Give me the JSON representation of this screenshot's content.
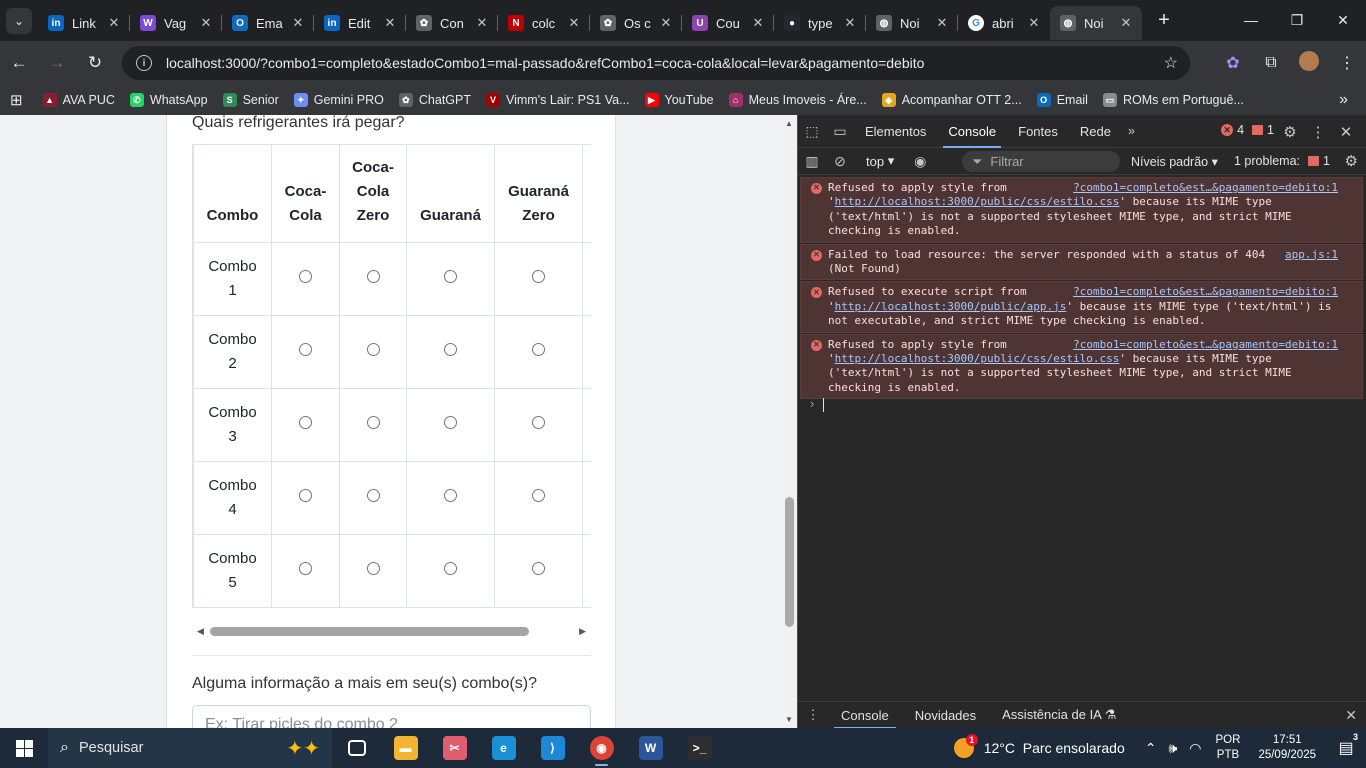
{
  "browser": {
    "tabs": [
      {
        "label": "Link",
        "icon": "linkedin-icon",
        "color": "#0a66c2",
        "glyph": "in"
      },
      {
        "label": "Vag",
        "icon": "vagas-icon",
        "color": "#7b4bd6",
        "glyph": "W"
      },
      {
        "label": "Ema",
        "icon": "outlook-icon",
        "color": "#0f6cbd",
        "glyph": "O"
      },
      {
        "label": "Edit",
        "icon": "linkedin-icon",
        "color": "#0a66c2",
        "glyph": "in"
      },
      {
        "label": "Con",
        "icon": "chatgpt-icon",
        "color": "#5f6368",
        "glyph": "✿"
      },
      {
        "label": "colc",
        "icon": "netflix-icon",
        "color": "#c00000",
        "glyph": "N"
      },
      {
        "label": "Os c",
        "icon": "chatgpt-icon",
        "color": "#5f6368",
        "glyph": "✿"
      },
      {
        "label": "Cou",
        "icon": "purple-app-icon",
        "color": "#8e44ad",
        "glyph": "U"
      },
      {
        "label": "type",
        "icon": "github-icon",
        "color": "#24292f",
        "glyph": "●"
      },
      {
        "label": "Noi",
        "icon": "globe-icon",
        "color": "#5f6368",
        "glyph": "◍"
      },
      {
        "label": "abri",
        "icon": "google-icon",
        "color": "#ffffff",
        "glyph": "G"
      },
      {
        "label": "Noi",
        "icon": "globe-icon",
        "color": "#5f6368",
        "glyph": "◍",
        "active": true
      }
    ],
    "url": "localhost:3000/?combo1=completo&estadoCombo1=mal-passado&refCombo1=coca-cola&local=levar&pagamento=debito",
    "bookmarks": [
      {
        "label": "AVA PUC",
        "icon": "ava-icon",
        "color": "#8b1e2d",
        "glyph": "▲"
      },
      {
        "label": "WhatsApp",
        "icon": "whatsapp-icon",
        "color": "#25d366",
        "glyph": "✆"
      },
      {
        "label": "Senior",
        "icon": "senior-icon",
        "color": "#2e8b57",
        "glyph": "S"
      },
      {
        "label": "Gemini PRO",
        "icon": "gemini-icon",
        "color": "#6a8cff",
        "glyph": "✦"
      },
      {
        "label": "ChatGPT",
        "icon": "chatgpt-icon",
        "color": "#5f6368",
        "glyph": "✿"
      },
      {
        "label": "Vimm's Lair: PS1 Va...",
        "icon": "vimm-icon",
        "color": "#a00000",
        "glyph": "V"
      },
      {
        "label": "YouTube",
        "icon": "youtube-icon",
        "color": "#ff0000",
        "glyph": "▶"
      },
      {
        "label": "Meus Imoveis - Áre...",
        "icon": "imoveis-icon",
        "color": "#a0306b",
        "glyph": "⌂"
      },
      {
        "label": "Acompanhar OTT 2...",
        "icon": "ott-icon",
        "color": "#e3a81b",
        "glyph": "◆"
      },
      {
        "label": "Email",
        "icon": "outlook-icon",
        "color": "#0f6cbd",
        "glyph": "O"
      },
      {
        "label": "ROMs em Portuguê...",
        "icon": "folder-icon",
        "color": "#8a8a8a",
        "glyph": "▭"
      }
    ]
  },
  "form": {
    "question": "Quais refrigerantes irá pegar?",
    "columns": [
      "Combo",
      "Coca-\nCola",
      "Coca-\nCola\nZero",
      "Guaraná",
      "Guaraná\nZero"
    ],
    "rows": [
      "Combo\n1",
      "Combo\n2",
      "Combo\n3",
      "Combo\n4",
      "Combo\n5"
    ],
    "extra_label": "Alguma informação a mais em seu(s) combo(s)?",
    "extra_placeholder": "Ex: Tirar picles do combo 2"
  },
  "devtools": {
    "tabs": [
      "Elementos",
      "Console",
      "Fontes",
      "Rede"
    ],
    "active_tab": "Console",
    "error_count": "4",
    "issue_count": "1",
    "context": "top",
    "filter_placeholder": "Filtrar",
    "levels": "Níveis padrão",
    "problems": "1 problema:",
    "problems_count": "1",
    "messages": [
      {
        "source": "?combo1=completo&est…&pagamento=debito:1",
        "pre": "Refused to apply style from '",
        "link": "http://localhost:3000/public/css/estilo.css",
        "post": "' because its MIME type ('text/html') is not a supported stylesheet MIME type, and strict MIME checking is enabled."
      },
      {
        "source": "app.js:1",
        "pre": "Failed to load resource: the server responded with a status of 404 (Not Found)",
        "link": "",
        "post": ""
      },
      {
        "source": "?combo1=completo&est…&pagamento=debito:1",
        "pre": "Refused to execute script from '",
        "link": "http://localhost:3000/public/app.js",
        "post": "' because its MIME type ('text/html') is not executable, and strict MIME type checking is enabled."
      },
      {
        "source": "?combo1=completo&est…&pagamento=debito:1",
        "pre": "Refused to apply style from '",
        "link": "http://localhost:3000/public/css/estilo.css",
        "post": "' because its MIME type ('text/html') is not a supported stylesheet MIME type, and strict MIME checking is enabled."
      }
    ],
    "drawer_tabs": [
      "Console",
      "Novidades",
      "Assistência de IA ⚗"
    ]
  },
  "taskbar": {
    "search": "Pesquisar",
    "apps": [
      {
        "name": "task-view-icon",
        "color": "#1c2a3a",
        "glyph": "▣"
      },
      {
        "name": "file-explorer-icon",
        "color": "#f3b52f",
        "glyph": "▬"
      },
      {
        "name": "snipping-tool-icon",
        "color": "#e05d6f",
        "glyph": "✂"
      },
      {
        "name": "edge-icon",
        "color": "#1b8fd6",
        "glyph": "e"
      },
      {
        "name": "vscode-icon",
        "color": "#1e88d8",
        "glyph": "⟩"
      },
      {
        "name": "chrome-icon",
        "color": "#db4437",
        "glyph": "◉"
      },
      {
        "name": "word-icon",
        "color": "#2b579a",
        "glyph": "W"
      },
      {
        "name": "terminal-icon",
        "color": "#2d2d2d",
        "glyph": ">_"
      }
    ],
    "weather": "12°C  Parc ensolarado",
    "weather_badge": "1",
    "lang1": "POR",
    "lang2": "PTB",
    "time": "17:51",
    "date": "25/09/2025",
    "notif_count": "3"
  }
}
